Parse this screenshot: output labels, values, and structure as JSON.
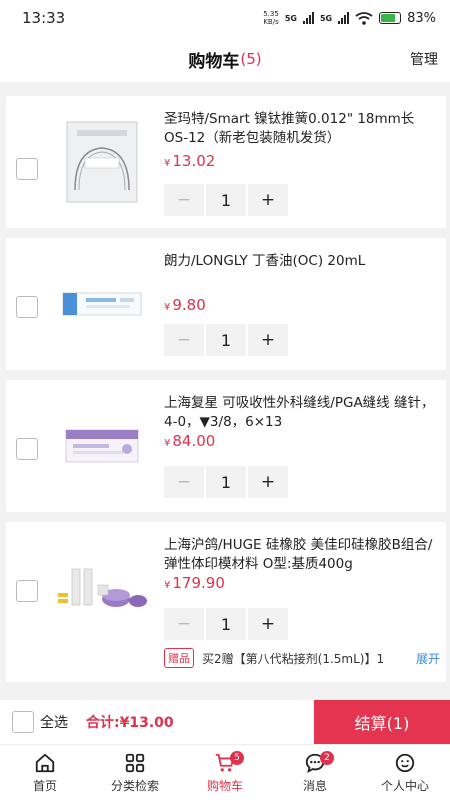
{
  "status_bar": {
    "time": "13:33",
    "net_speed_value": "5.35",
    "net_speed_unit": "KB/s",
    "network1": "5G",
    "network2": "5G",
    "battery": "83%"
  },
  "header": {
    "title": "购物车",
    "count": "(5)",
    "manage": "管理"
  },
  "items": [
    {
      "title": "圣玛特/Smart 镍钛推簧0.012\" 18mm长 OS-12（新老包装随机发货）",
      "currency": "¥",
      "price": "13.02",
      "qty": "1",
      "minus": "−",
      "plus": "+"
    },
    {
      "title": "朗力/LONGLY 丁香油(OC) 20mL",
      "currency": "¥",
      "price": "9.80",
      "qty": "1",
      "minus": "−",
      "plus": "+"
    },
    {
      "title": "上海复星 可吸收性外科缝线/PGA缝线 缝针，4-0，▼3/8，6×13",
      "currency": "¥",
      "price": "84.00",
      "qty": "1",
      "minus": "−",
      "plus": "+"
    },
    {
      "title": "上海沪鸽/HUGE 硅橡胶 美佳印硅橡胶B组合/弹性体印模材料 O型:基质400g",
      "currency": "¥",
      "price": "179.90",
      "qty": "1",
      "minus": "−",
      "plus": "+",
      "gift_tag": "赠品",
      "gift_text": "买2赠【第八代粘接剂(1.5mL)】1",
      "gift_expand": "展开"
    }
  ],
  "checkout": {
    "select_all": "全选",
    "total": "合计:¥13.00",
    "settle": "结算(1)"
  },
  "tabbar": [
    {
      "label": "首页",
      "icon": "home-icon"
    },
    {
      "label": "分类检索",
      "icon": "category-icon"
    },
    {
      "label": "购物车",
      "icon": "cart-icon",
      "badge": "5"
    },
    {
      "label": "消息",
      "icon": "message-icon",
      "badge": "2"
    },
    {
      "label": "个人中心",
      "icon": "profile-icon"
    }
  ],
  "colors": {
    "accent": "#e0314d",
    "link": "#3a8cd6"
  }
}
